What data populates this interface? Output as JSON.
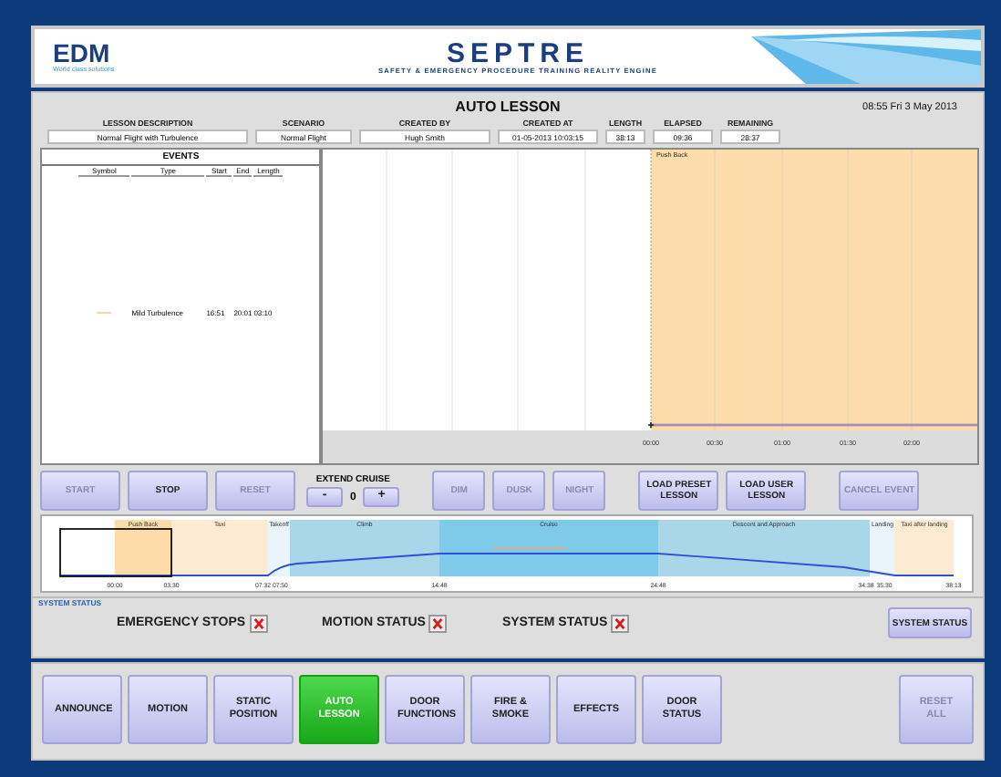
{
  "header": {
    "logo": "EDM",
    "tagline": "World class solutions",
    "title": "SEPTRE",
    "subtitle": "SAFETY & EMERGENCY PROCEDURE TRAINING REALITY ENGINE"
  },
  "lesson": {
    "title": "AUTO LESSON",
    "datetime": "08:55 Fri 3 May 2013",
    "fields": [
      {
        "label": "LESSON DESCRIPTION",
        "value": "Normal Flight with Turbulence"
      },
      {
        "label": "SCENARIO",
        "value": "Normal Flight"
      },
      {
        "label": "CREATED BY",
        "value": "Hugh Smith"
      },
      {
        "label": "CREATED AT",
        "value": "01-05-2013 10:03:15"
      },
      {
        "label": "LENGTH",
        "value": "38:13"
      },
      {
        "label": "ELAPSED",
        "value": "09:36"
      },
      {
        "label": "REMAINING",
        "value": "28:37"
      }
    ]
  },
  "events": {
    "title": "EVENTS",
    "columns": [
      "Symbol",
      "Type",
      "Start",
      "End",
      "Length"
    ],
    "rows": [
      {
        "color": "#f0d8a8",
        "type": "Mild Turbulence",
        "start": "16:51",
        "end": "20:01",
        "length": "03:10"
      }
    ]
  },
  "timeline_chart": {
    "marker": "Push Back",
    "ticks": [
      "00:00",
      "00:30",
      "01:00",
      "01:30",
      "02:00"
    ]
  },
  "controls": [
    {
      "kind": "button",
      "label": "START",
      "disabled": true
    },
    {
      "kind": "button",
      "label": "STOP",
      "disabled": false
    },
    {
      "kind": "button",
      "label": "RESET",
      "disabled": true
    },
    {
      "kind": "stepper",
      "label": "EXTEND CRUISE",
      "minus": "-",
      "value": "0",
      "plus": "+"
    },
    {
      "kind": "button",
      "label": "DIM",
      "disabled": true
    },
    {
      "kind": "button",
      "label": "DUSK",
      "disabled": true
    },
    {
      "kind": "button",
      "label": "NIGHT",
      "disabled": true
    },
    {
      "kind": "button",
      "label": "LOAD PRESET LESSON",
      "disabled": false
    },
    {
      "kind": "button",
      "label": "LOAD USER LESSON",
      "disabled": false
    },
    {
      "kind": "button",
      "label": "CANCEL EVENT",
      "disabled": true
    }
  ],
  "phases": {
    "segments": [
      {
        "label": "Push Back",
        "color": "#fddcaa"
      },
      {
        "label": "Taxi",
        "color": "#fcead2"
      },
      {
        "label": "Takeoff",
        "color": "#eaf5fb"
      },
      {
        "label": "Climb",
        "color": "#a9d6e8"
      },
      {
        "label": "Cruise",
        "color": "#7ecae8"
      },
      {
        "label": "Descent and Approach",
        "color": "#a9d6e8"
      },
      {
        "label": "Landing",
        "color": "#eaf5fb"
      },
      {
        "label": "Taxi after landing",
        "color": "#fcead2"
      }
    ],
    "ticks": [
      "00:00",
      "03:30",
      "07:32 07:50",
      "14:48",
      "24:48",
      "34:38",
      "35:30",
      "38:13"
    ]
  },
  "system_status": {
    "title": "SYSTEM STATUS",
    "indicators": [
      {
        "label": "EMERGENCY STOPS",
        "ok": false
      },
      {
        "label": "MOTION STATUS",
        "ok": false
      },
      {
        "label": "SYSTEM STATUS",
        "ok": false
      }
    ],
    "button": "SYSTEM STATUS"
  },
  "nav": [
    {
      "label": "ANNOUNCE",
      "selected": false
    },
    {
      "label": "MOTION",
      "selected": false
    },
    {
      "label": "STATIC POSITION",
      "selected": false
    },
    {
      "label": "AUTO LESSON",
      "selected": true
    },
    {
      "label": "DOOR FUNCTIONS",
      "selected": false
    },
    {
      "label": "FIRE & SMOKE",
      "selected": false
    },
    {
      "label": "EFFECTS",
      "selected": false
    },
    {
      "label": "DOOR STATUS",
      "selected": false
    }
  ],
  "reset_button": {
    "label": "RESET ALL",
    "disabled": true
  }
}
